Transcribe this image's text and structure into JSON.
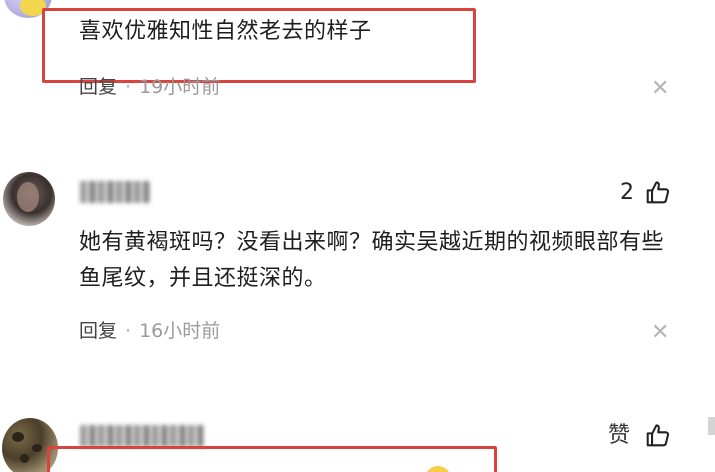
{
  "colors": {
    "highlight_border": "#d9443f",
    "text": "#1e1e1e",
    "meta_time": "#9a9a9a",
    "close_icon": "#b5b5b5"
  },
  "comments": [
    {
      "username": "",
      "text": "喜欢优雅知性自然老去的样子",
      "reply_label": "回复",
      "separator": "·",
      "time": "19小时前",
      "close_icon": "close-icon",
      "highlighted": true
    },
    {
      "username": "",
      "like_count": "2",
      "like_icon": "thumbs-up-icon",
      "text": "她有黄褐斑吗？没看出来啊？确实吴越近期的视频眼部有些鱼尾纹，并且还挺深的。",
      "reply_label": "回复",
      "separator": "·",
      "time": "16小时前",
      "close_icon": "close-icon"
    },
    {
      "username": "",
      "like_label": "赞",
      "like_icon": "thumbs-up-icon",
      "highlighted": true
    }
  ]
}
